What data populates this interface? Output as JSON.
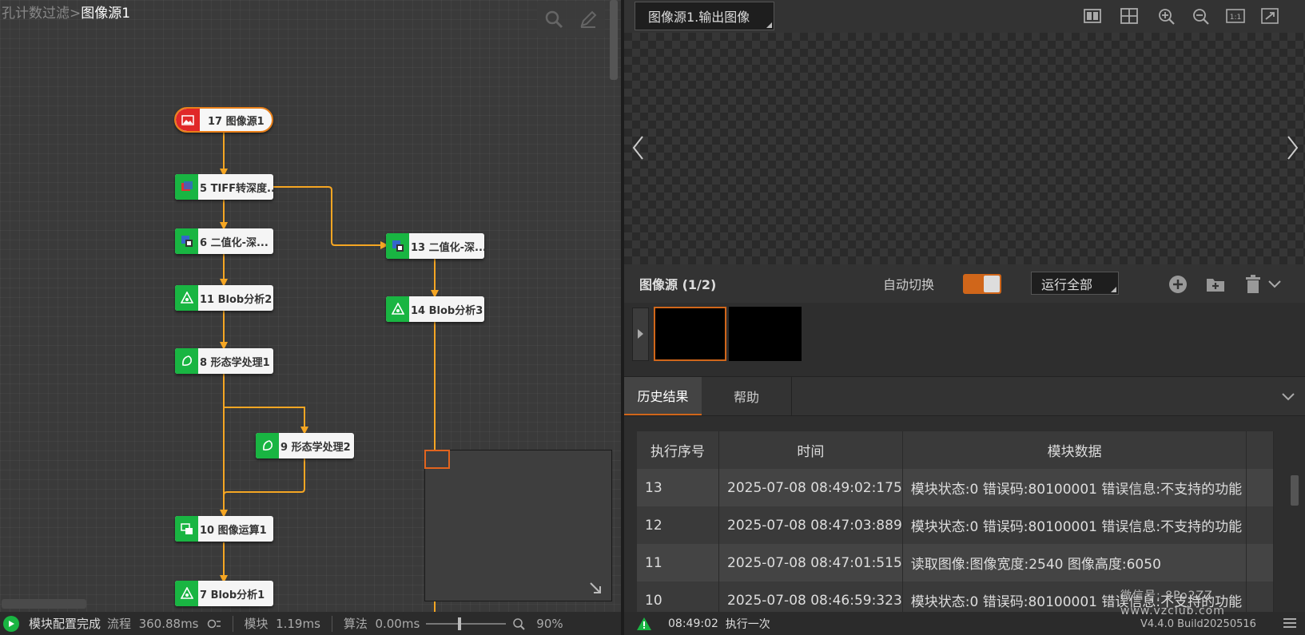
{
  "breadcrumb": {
    "parent": "孔计数过滤",
    "separator": ">",
    "current": "图像源1"
  },
  "flow": {
    "nodes": [
      {
        "id": "17",
        "label": "17 图像源1",
        "icon": "image-source-icon"
      },
      {
        "id": "5",
        "label": "5 TIFF转深度...",
        "icon": "depth-convert-icon"
      },
      {
        "id": "6",
        "label": "6 二值化-深...",
        "icon": "binarize-icon"
      },
      {
        "id": "13",
        "label": "13 二值化-深...",
        "icon": "binarize-icon"
      },
      {
        "id": "11",
        "label": "11 Blob分析2",
        "icon": "blob-analysis-icon"
      },
      {
        "id": "14",
        "label": "14 Blob分析3",
        "icon": "blob-analysis-icon"
      },
      {
        "id": "8",
        "label": "8 形态学处理1",
        "icon": "morphology-icon"
      },
      {
        "id": "9",
        "label": "9 形态学处理2",
        "icon": "morphology-icon"
      },
      {
        "id": "10",
        "label": "10 图像运算1",
        "icon": "image-arithmetic-icon"
      },
      {
        "id": "7",
        "label": "7 Blob分析1",
        "icon": "blob-analysis-icon"
      }
    ],
    "colors": {
      "link": "#f5a623",
      "node_icon_green": "#19b542",
      "source_red": "#e02828",
      "source_border": "#e8801a"
    }
  },
  "status_left": {
    "state": "模块配置完成",
    "flow_label": "流程",
    "flow_time": "360.88ms",
    "module_label": "模块",
    "module_time": "1.19ms",
    "algo_label": "算法",
    "algo_time": "0.00ms",
    "zoom": "90%",
    "zoom_fraction": 0.4
  },
  "image_panel": {
    "selector_value": "图像源1.输出图像",
    "source_title": "图像源 (1/2)",
    "auto_switch_label": "自动切换",
    "auto_switch_on": true,
    "run_button": "运行全部",
    "thumb_count": 2,
    "selected_thumb": 0
  },
  "tabs": [
    {
      "label": "历史结果",
      "active": true
    },
    {
      "label": "帮助",
      "active": false
    }
  ],
  "history": {
    "columns": [
      "执行序号",
      "时间",
      "模块数据"
    ],
    "rows": [
      {
        "seq": "13",
        "time": "2025-07-08 08:49:02:175",
        "data": "模块状态:0 错误码:80100001 错误信息:不支持的功能"
      },
      {
        "seq": "12",
        "time": "2025-07-08 08:47:03:889",
        "data": "模块状态:0 错误码:80100001 错误信息:不支持的功能"
      },
      {
        "seq": "11",
        "time": "2025-07-08 08:47:01:515",
        "data": "读取图像:图像宽度:2540 图像高度:6050"
      },
      {
        "seq": "10",
        "time": "2025-07-08 08:46:59:323",
        "data": "模块状态:0 错误码:80100001 错误信息:不支持的功能"
      }
    ]
  },
  "footer_right": {
    "time": "08:49:02",
    "action": "执行一次",
    "version": "V4.4.0 Build20250516"
  },
  "watermark": {
    "line1": "微信号: 8Po2ZZ",
    "line2": "www.vzclub.com"
  },
  "accent": "#d0661a"
}
